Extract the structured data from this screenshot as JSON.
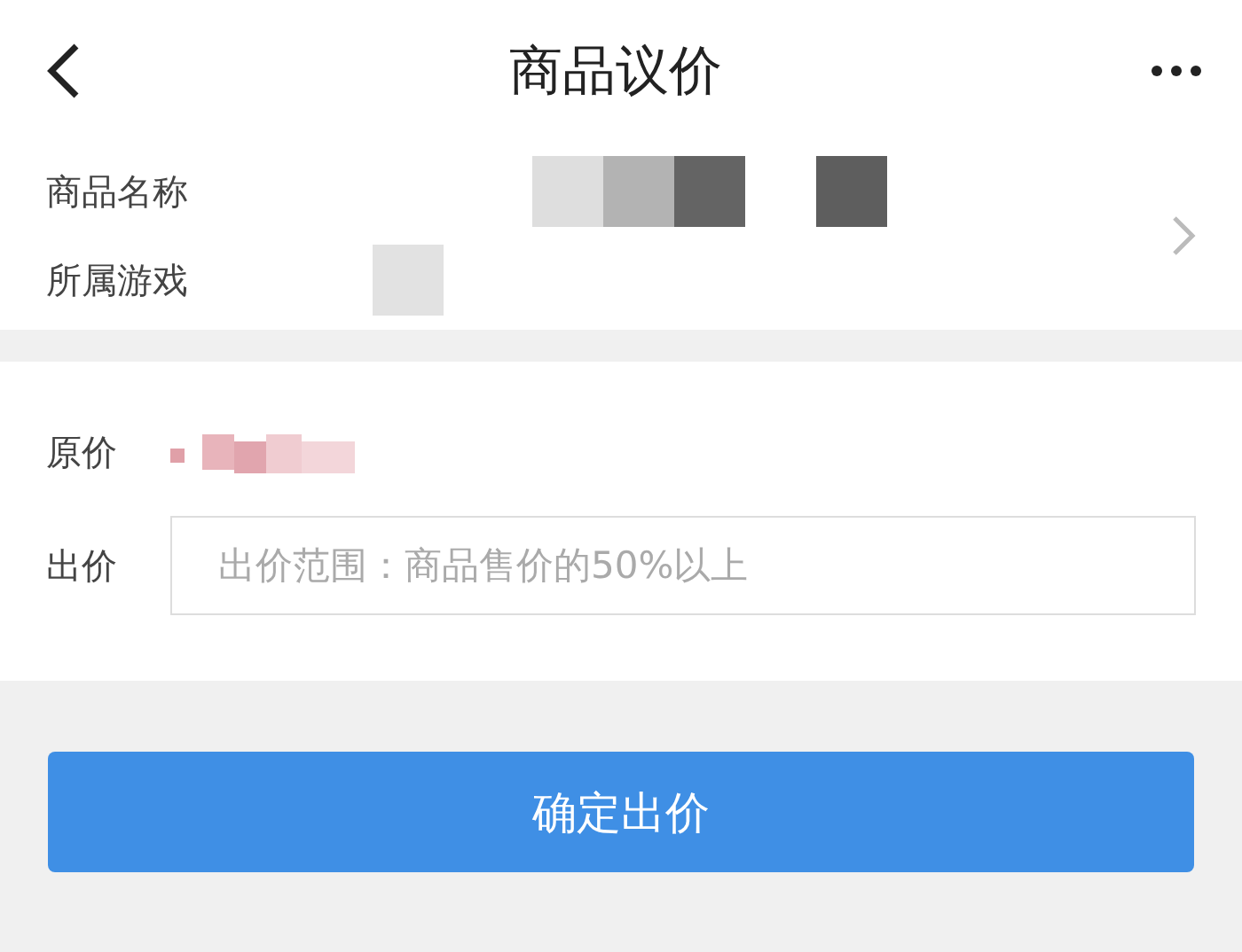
{
  "header": {
    "title": "商品议价"
  },
  "product": {
    "rows": [
      {
        "label": "商品名称"
      },
      {
        "label": "所属游戏"
      }
    ]
  },
  "offer": {
    "original_price_label": "原价",
    "bid_label": "出价",
    "bid_placeholder": "出价范围：商品售价的50%以上"
  },
  "buttons": [
    "确定出价"
  ]
}
